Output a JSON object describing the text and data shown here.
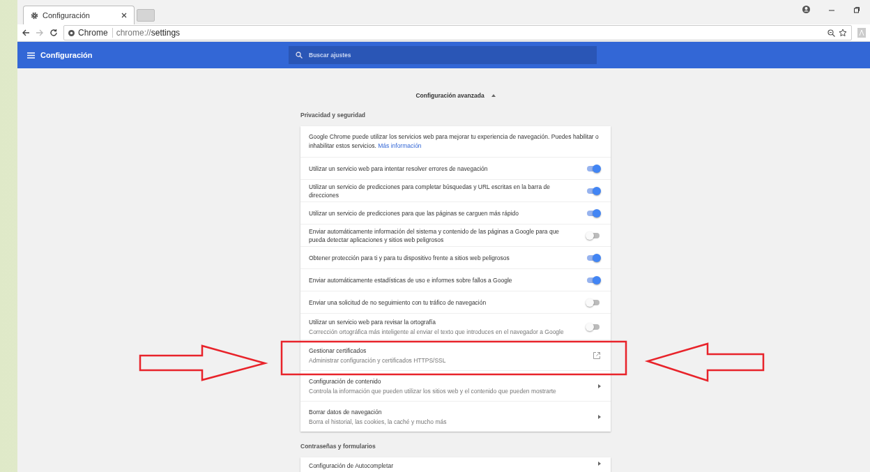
{
  "tab": {
    "title": "Configuración"
  },
  "toolbar": {
    "origin": "Chrome",
    "url_scheme": "chrome://",
    "url_path": "settings",
    "forward_disabled": true
  },
  "header": {
    "title": "Configuración",
    "search": {
      "placeholder": "Buscar ajustes"
    }
  },
  "advanced": {
    "label": "Configuración avanzada",
    "expanded": true
  },
  "sections": [
    {
      "title": "Privacidad y seguridad",
      "items": [
        {
          "kind": "info",
          "text": "Google Chrome puede utilizar los servicios web para mejorar tu experiencia de navegación. Puedes habilitar o inhabilitar estos servicios.",
          "link": "Más información"
        },
        {
          "kind": "toggle",
          "label": "Utilizar un servicio web para intentar resolver errores de navegación",
          "on": true
        },
        {
          "kind": "toggle",
          "label": "Utilizar un servicio de predicciones para completar búsquedas y URL escritas en la barra de direcciones",
          "on": true
        },
        {
          "kind": "toggle",
          "label": "Utilizar un servicio de predicciones para que las páginas se carguen más rápido",
          "on": true
        },
        {
          "kind": "toggle",
          "label": "Enviar automáticamente información del sistema y contenido de las páginas a Google para que pueda detectar aplicaciones y sitios web peligrosos",
          "on": false
        },
        {
          "kind": "toggle",
          "label": "Obtener protección para ti y para tu dispositivo frente a sitios web peligrosos",
          "on": true
        },
        {
          "kind": "toggle",
          "label": "Enviar automáticamente estadísticas de uso e informes sobre fallos a Google",
          "on": true
        },
        {
          "kind": "toggle",
          "label": "Enviar una solicitud de no seguimiento con tu tráfico de navegación",
          "on": false
        },
        {
          "kind": "toggle",
          "label": "Utilizar un servicio web para revisar la ortografía",
          "sublabel": "Corrección ortográfica más inteligente al enviar el texto que introduces en el navegador a Google",
          "on": false
        },
        {
          "kind": "external",
          "label": "Gestionar certificados",
          "sublabel": "Administrar configuración y certificados HTTPS/SSL"
        },
        {
          "kind": "submenu",
          "label": "Configuración de contenido",
          "sublabel": "Controla la información que pueden utilizar los sitios web y el contenido que pueden mostrarte"
        },
        {
          "kind": "submenu",
          "label": "Borrar datos de navegación",
          "sublabel": "Borra el historial, las cookies, la caché y mucho más"
        }
      ]
    },
    {
      "title": "Contraseñas y formularios",
      "items": [
        {
          "kind": "submenu",
          "label": "Configuración de Autocompletar"
        }
      ]
    }
  ]
}
